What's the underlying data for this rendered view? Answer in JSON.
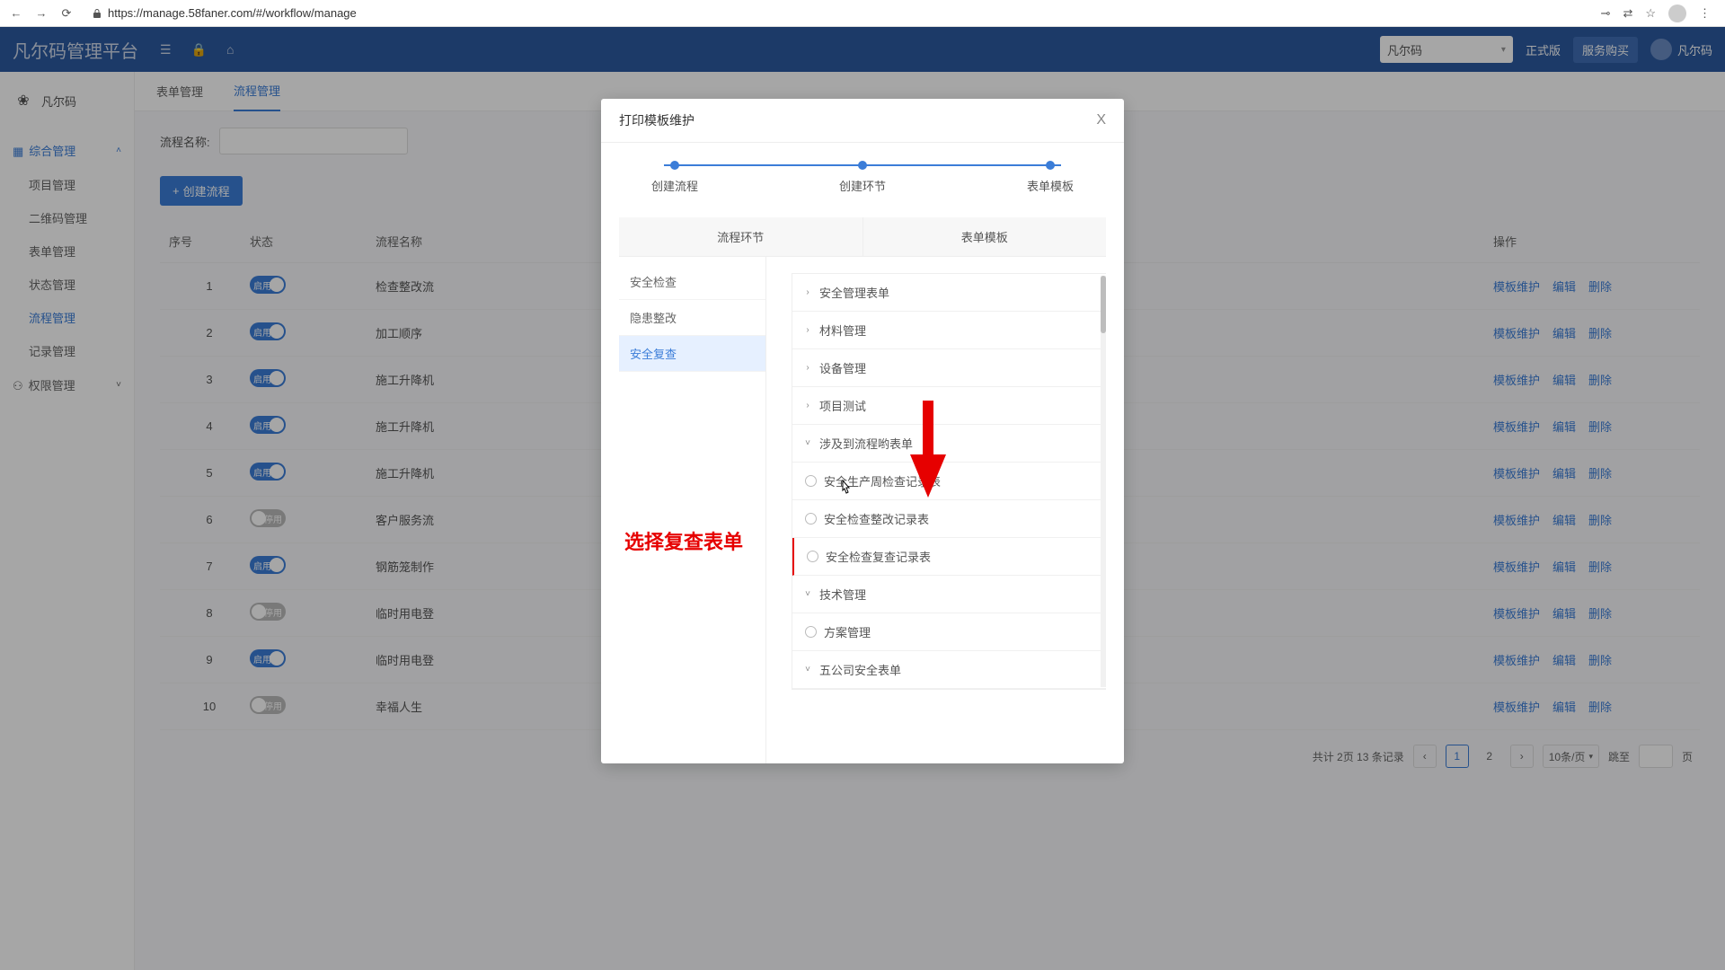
{
  "browser": {
    "url": "https://manage.58faner.com/#/workflow/manage"
  },
  "header": {
    "app_title": "凡尔码管理平台",
    "search_value": "凡尔码",
    "version_label": "正式版",
    "buy_label": "服务购买",
    "username": "凡尔码"
  },
  "sidebar": {
    "org": "凡尔码",
    "cat1": "综合管理",
    "items1": [
      "项目管理",
      "二维码管理",
      "表单管理",
      "状态管理",
      "流程管理",
      "记录管理"
    ],
    "active1_index": 4,
    "cat2": "权限管理"
  },
  "tabs": {
    "t1": "表单管理",
    "t2": "流程管理",
    "active": 1
  },
  "filter": {
    "label": "流程名称:"
  },
  "create_btn": "创建流程",
  "table": {
    "headers": [
      "序号",
      "状态",
      "流程名称",
      "操作"
    ],
    "action_labels": [
      "模板维护",
      "编辑",
      "删除"
    ],
    "rows": [
      {
        "idx": "1",
        "on": true,
        "on_label": "启用",
        "name": "检查整改流"
      },
      {
        "idx": "2",
        "on": true,
        "on_label": "启用",
        "name": "加工顺序"
      },
      {
        "idx": "3",
        "on": true,
        "on_label": "启用",
        "name": "施工升降机"
      },
      {
        "idx": "4",
        "on": true,
        "on_label": "启用",
        "name": "施工升降机"
      },
      {
        "idx": "5",
        "on": true,
        "on_label": "启用",
        "name": "施工升降机"
      },
      {
        "idx": "6",
        "on": false,
        "on_label": "停用",
        "name": "客户服务流"
      },
      {
        "idx": "7",
        "on": true,
        "on_label": "启用",
        "name": "钢筋笼制作"
      },
      {
        "idx": "8",
        "on": false,
        "on_label": "停用",
        "name": "临时用电登"
      },
      {
        "idx": "9",
        "on": true,
        "on_label": "启用",
        "name": "临时用电登"
      },
      {
        "idx": "10",
        "on": false,
        "on_label": "停用",
        "name": "幸福人生"
      }
    ]
  },
  "pager": {
    "summary": "共计 2页 13 条记录",
    "page1": "1",
    "page2": "2",
    "per_page": "10条/页",
    "jump_label": "跳至",
    "page_suffix": "页"
  },
  "modal": {
    "title": "打印模板维护",
    "steps": [
      "创建流程",
      "创建环节",
      "表单模板"
    ],
    "inner_tabs": [
      "流程环节",
      "表单模板"
    ],
    "left_items": [
      "安全检查",
      "隐患整改",
      "安全复查"
    ],
    "left_active": 2,
    "annotation": "选择复查表单",
    "tree": [
      {
        "label": "安全管理表单",
        "expanded": false
      },
      {
        "label": "材料管理",
        "expanded": false
      },
      {
        "label": "设备管理",
        "expanded": false
      },
      {
        "label": "项目测试",
        "expanded": false
      },
      {
        "label": "涉及到流程哟表单",
        "expanded": true,
        "children": [
          {
            "label": "安全生产周检查记录表"
          },
          {
            "label": "安全检查整改记录表"
          },
          {
            "label": "安全检查复查记录表",
            "highlight": true
          }
        ]
      },
      {
        "label": "技术管理",
        "expanded": true,
        "children": [
          {
            "label": "方案管理"
          }
        ]
      },
      {
        "label": "五公司安全表单",
        "expanded": true
      }
    ]
  }
}
